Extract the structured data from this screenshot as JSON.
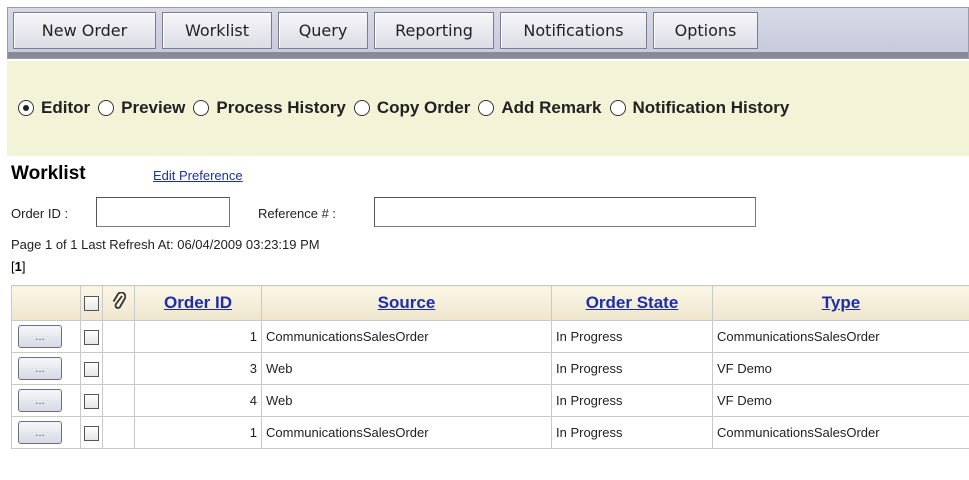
{
  "toolbar": {
    "buttons": [
      {
        "label": "New Order"
      },
      {
        "label": "Worklist"
      },
      {
        "label": "Query"
      },
      {
        "label": "Reporting"
      },
      {
        "label": "Notifications"
      },
      {
        "label": "Options"
      }
    ]
  },
  "view_options": {
    "selected": "Editor",
    "items": [
      {
        "label": "Editor"
      },
      {
        "label": "Preview"
      },
      {
        "label": "Process History"
      },
      {
        "label": "Copy Order"
      },
      {
        "label": "Add Remark"
      },
      {
        "label": "Notification History"
      }
    ]
  },
  "worklist": {
    "title": "Worklist",
    "edit_preference": "Edit Preference",
    "order_id_label": "Order ID :",
    "order_id_value": "",
    "reference_label": "Reference # :",
    "reference_value": "",
    "page_info": "Page 1 of 1   Last Refresh At: 06/04/2009 03:23:19 PM",
    "page_links": "1"
  },
  "table": {
    "columns": {
      "order_id": "Order ID",
      "source": "Source",
      "order_state": "Order State",
      "type": "Type"
    },
    "rows": [
      {
        "action": "...",
        "order_id": "1",
        "source": "CommunicationsSalesOrder",
        "order_state": "In Progress",
        "type": "CommunicationsSalesOrder"
      },
      {
        "action": "...",
        "order_id": "3",
        "source": "Web",
        "order_state": "In Progress",
        "type": "VF Demo"
      },
      {
        "action": "...",
        "order_id": "4",
        "source": "Web",
        "order_state": "In Progress",
        "type": "VF Demo"
      },
      {
        "action": "...",
        "order_id": "1",
        "source": "CommunicationsSalesOrder",
        "order_state": "In Progress",
        "type": "CommunicationsSalesOrder"
      }
    ]
  }
}
